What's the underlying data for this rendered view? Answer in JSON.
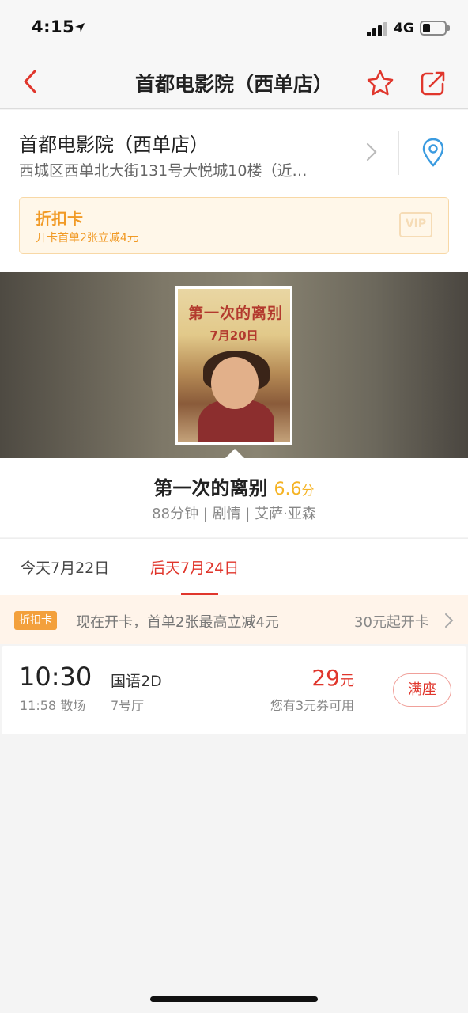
{
  "status_bar": {
    "time": "4:15",
    "network": "4G"
  },
  "nav": {
    "title": "首都电影院（西单店）"
  },
  "cinema": {
    "name": "首都电影院（西单店）",
    "address": "西城区西单北大街131号大悦城10楼（近…"
  },
  "discount_card": {
    "title": "折扣卡",
    "subtitle": "开卡首单2张立减4元",
    "vip_label": "VIP"
  },
  "poster": {
    "title": "第一次的离别",
    "date": "7月20日"
  },
  "movie": {
    "title": "第一次的离别",
    "score": "6.6",
    "score_unit": "分",
    "meta": "88分钟 | 剧情 | 艾萨·亚森"
  },
  "dates": [
    {
      "label": "今天7月22日",
      "selected": false
    },
    {
      "label": "后天7月24日",
      "selected": true
    }
  ],
  "promo": {
    "badge": "折扣卡",
    "text": "现在开卡，首单2张最高立减4元",
    "cta": "30元起开卡"
  },
  "showtimes": [
    {
      "start": "10:30",
      "end": "11:58 散场",
      "language": "国语2D",
      "hall": "7号厅",
      "price": "29",
      "price_unit": "元",
      "coupon": "您有3元券可用",
      "status": "满座"
    }
  ],
  "colors": {
    "accent": "#e0362c",
    "promo_orange": "#f19a25",
    "score_yellow": "#f5b324"
  },
  "icons": {
    "back": "chevron-left-icon",
    "favorite": "star-outline-icon",
    "share": "share-icon",
    "location": "location-pin-icon"
  }
}
